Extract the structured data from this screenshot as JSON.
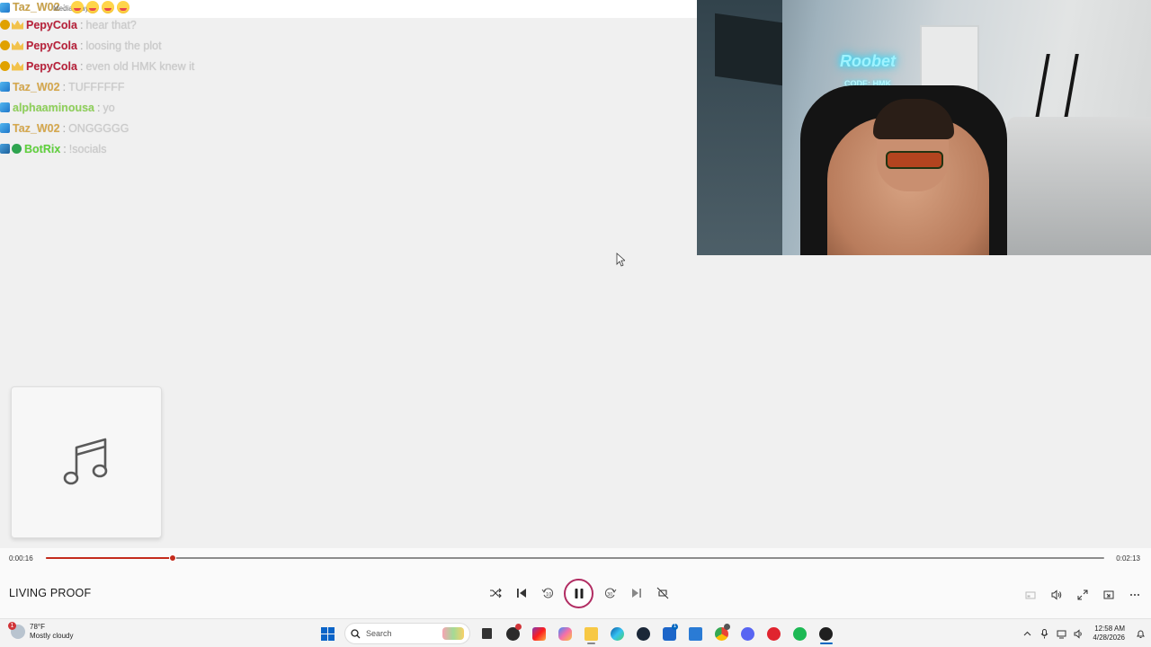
{
  "chat": {
    "messages": [
      {
        "username": "Taz_W02",
        "separator": ":",
        "text": "",
        "color": "#c9a24a",
        "badges": [
          "cube"
        ],
        "emotes": 4,
        "overlap_label": "Media Player"
      },
      {
        "username": "PepyCola",
        "separator": ":",
        "text": "hear that?",
        "color": "#b8213a",
        "badges": [
          "coin",
          "crown"
        ]
      },
      {
        "username": "PepyCola",
        "separator": ":",
        "text": "loosing the plot",
        "color": "#b8213a",
        "badges": [
          "coin",
          "crown"
        ]
      },
      {
        "username": "PepyCola",
        "separator": ":",
        "text": "even old HMK knew it",
        "color": "#b8213a",
        "badges": [
          "coin",
          "crown"
        ]
      },
      {
        "username": "Taz_W02",
        "separator": ":",
        "text": "TUFFFFFF",
        "color": "#d6a84d",
        "badges": [
          "cube"
        ]
      },
      {
        "username": "alphaaminousa",
        "separator": ":",
        "text": "yo",
        "color": "#8fd15a",
        "badges": [
          "cube"
        ]
      },
      {
        "username": "Taz_W02",
        "separator": ":",
        "text": "ONGGGGG",
        "color": "#d6a84d",
        "badges": [
          "cube"
        ]
      },
      {
        "username": "BotRix",
        "separator": ":",
        "text": "!socials",
        "color": "#5fd13c",
        "badges": [
          "mod",
          "verified"
        ]
      }
    ]
  },
  "webcam": {
    "neon_sign": "Roobet",
    "neon_code": "CODE: HMK"
  },
  "player": {
    "current_time": "0:00:16",
    "total_time": "0:02:13",
    "progress_fraction": 0.12,
    "track_title": "LIVING PROOF",
    "state": "playing",
    "accent_color": "#c42b1c",
    "controls": [
      "shuffle-icon",
      "previous-icon",
      "rewind-10-icon",
      "pause-icon",
      "forward-30-icon",
      "next-icon",
      "repeat-off-icon"
    ],
    "right_controls": [
      "miniplayer-icon",
      "volume-icon",
      "fullscreen-icon",
      "cast-icon",
      "more-icon"
    ],
    "album_art_icon": "music-note-icon"
  },
  "taskbar": {
    "weather": {
      "temp": "78°F",
      "condition": "Mostly cloudy",
      "badge": "1"
    },
    "search_placeholder": "Search",
    "pinned": [
      "windows-start-icon",
      "search-icon",
      "task-view-icon",
      "obs-icon",
      "instagram-icon",
      "copilot-icon",
      "file-explorer-icon",
      "edge-icon",
      "steam-icon",
      "microsoft-store-icon",
      "mail-icon",
      "chrome-icon",
      "discord-icon",
      "app-red-icon",
      "spotify-icon",
      "media-player-icon"
    ],
    "store_badge": "1",
    "clock_time": "12:58 AM",
    "clock_date": "4/28/2026"
  }
}
